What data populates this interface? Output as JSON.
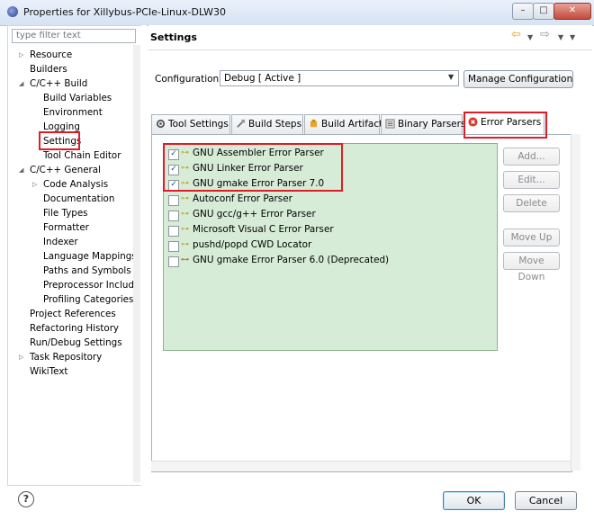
{
  "window": {
    "title": "Properties for Xillybus-PCIe-Linux-DLW30",
    "min_glyph": "–",
    "max_glyph": "□",
    "close_glyph": "✕"
  },
  "filter": {
    "placeholder": "type filter text"
  },
  "tree": [
    {
      "label": "Resource",
      "indent": 0,
      "expander": "▷"
    },
    {
      "label": "Builders",
      "indent": 0,
      "expander": ""
    },
    {
      "label": "C/C++ Build",
      "indent": 0,
      "expander": "◢"
    },
    {
      "label": "Build Variables",
      "indent": 1,
      "expander": ""
    },
    {
      "label": "Environment",
      "indent": 1,
      "expander": ""
    },
    {
      "label": "Logging",
      "indent": 1,
      "expander": ""
    },
    {
      "label": "Settings",
      "indent": 1,
      "expander": "",
      "selected": true
    },
    {
      "label": "Tool Chain Editor",
      "indent": 1,
      "expander": ""
    },
    {
      "label": "C/C++ General",
      "indent": 0,
      "expander": "◢"
    },
    {
      "label": "Code Analysis",
      "indent": 1,
      "expander": "▷"
    },
    {
      "label": "Documentation",
      "indent": 1,
      "expander": ""
    },
    {
      "label": "File Types",
      "indent": 1,
      "expander": ""
    },
    {
      "label": "Formatter",
      "indent": 1,
      "expander": ""
    },
    {
      "label": "Indexer",
      "indent": 1,
      "expander": ""
    },
    {
      "label": "Language Mappings",
      "indent": 1,
      "expander": ""
    },
    {
      "label": "Paths and Symbols",
      "indent": 1,
      "expander": ""
    },
    {
      "label": "Preprocessor Include",
      "indent": 1,
      "expander": ""
    },
    {
      "label": "Profiling Categories",
      "indent": 1,
      "expander": ""
    },
    {
      "label": "Project References",
      "indent": 0,
      "expander": ""
    },
    {
      "label": "Refactoring History",
      "indent": 0,
      "expander": ""
    },
    {
      "label": "Run/Debug Settings",
      "indent": 0,
      "expander": ""
    },
    {
      "label": "Task Repository",
      "indent": 0,
      "expander": "▷"
    },
    {
      "label": "WikiText",
      "indent": 0,
      "expander": ""
    }
  ],
  "header": {
    "title": "Settings",
    "nav_back": "⇦",
    "nav_forward": "⇨",
    "menu_glyph": "▼"
  },
  "configuration": {
    "label": "Configuration:",
    "value": "Debug  [ Active ]",
    "manage_button": "Manage Configurations..."
  },
  "tabs": [
    {
      "label": "Tool Settings",
      "icon": "tool-settings-icon"
    },
    {
      "label": "Build Steps",
      "icon": "build-steps-icon"
    },
    {
      "label": "Build Artifact",
      "icon": "build-artifact-icon"
    },
    {
      "label": "Binary Parsers",
      "icon": "binary-parsers-icon"
    },
    {
      "label": "Error Parsers",
      "icon": "error-parsers-icon",
      "active": true
    }
  ],
  "parsers": [
    {
      "label": "GNU Assembler Error Parser",
      "checked": true
    },
    {
      "label": "GNU Linker Error Parser",
      "checked": true
    },
    {
      "label": "GNU gmake Error Parser 7.0",
      "checked": true
    },
    {
      "label": "Autoconf Error Parser",
      "checked": false
    },
    {
      "label": "GNU gcc/g++ Error Parser",
      "checked": false
    },
    {
      "label": "Microsoft Visual C Error Parser",
      "checked": false
    },
    {
      "label": "pushd/popd CWD Locator",
      "checked": false
    },
    {
      "label": "GNU gmake Error Parser 6.0 (Deprecated)",
      "checked": false,
      "deprecated": true
    }
  ],
  "side_buttons": {
    "add": "Add...",
    "edit": "Edit...",
    "delete": "Delete",
    "move_up": "Move Up",
    "move_down": "Move Down"
  },
  "footer": {
    "help": "?",
    "ok": "OK",
    "cancel": "Cancel"
  },
  "colors": {
    "list_background": "#d7ecd7",
    "annotation_red": "#e01c28",
    "error_icon": "#d8382c"
  }
}
